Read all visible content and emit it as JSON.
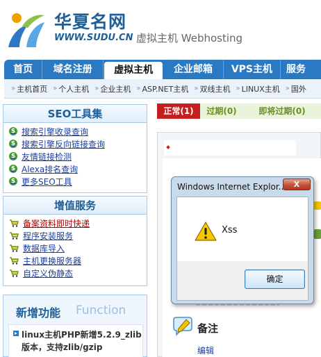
{
  "brand": {
    "name": "华夏名网",
    "url": "WWW.SUDU.CN",
    "tagline": "虚拟主机 Webhosting"
  },
  "main_nav": [
    {
      "label": "首页"
    },
    {
      "label": "域名注册"
    },
    {
      "label": "虚拟主机",
      "active": true
    },
    {
      "label": "企业邮箱"
    },
    {
      "label": "VPS主机"
    },
    {
      "label": "服务"
    }
  ],
  "sub_nav": [
    "主机首页",
    "个人主机",
    "企业主机",
    "ASP.NET主机",
    "双线主机",
    "LINUX主机",
    "国外"
  ],
  "seo_box": {
    "title": "SEO工具集",
    "items": [
      "搜索引擎收录查询",
      "搜索引擎反向链接查询",
      "友情链接检测",
      "Alexa排名查询",
      "更多SEO工具"
    ]
  },
  "vas_box": {
    "title": "增值服务",
    "items": [
      "备案资料即时快递",
      "程序安装服务",
      "数据库导入",
      "主机更换服务器",
      "自定义伪静态"
    ]
  },
  "new_box": {
    "title": "新增功能",
    "title_en": "Function",
    "item": "linux主机PHP新增5.2.9_zlib版本，支持zlib/gzip"
  },
  "status_tabs": [
    {
      "label": "正常(1)",
      "active": true
    },
    {
      "label": "过期(0)"
    },
    {
      "label": "即将过期(0)"
    }
  ],
  "note": {
    "label": "备注",
    "edit_link": "编辑"
  },
  "dialog": {
    "title": "Windows Internet Explor...",
    "message": "Xss",
    "ok_label": "确定",
    "close_label": "X"
  },
  "colors": {
    "brand_blue": "#1f5f98",
    "nav_blue": "#2a79c2",
    "active_red": "#c41e1e",
    "link_blue": "#1c3e9c"
  }
}
